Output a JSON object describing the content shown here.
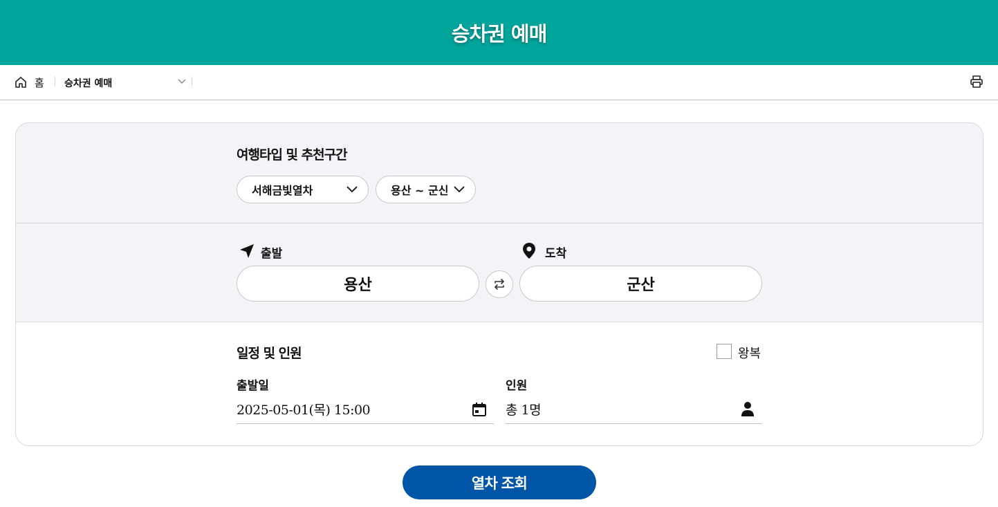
{
  "header": {
    "title": "승차권 예매"
  },
  "breadcrumb": {
    "home": "홈",
    "current": "승차권 예매"
  },
  "trip_type": {
    "title": "여행타입 및 추천구간",
    "type_select": "서해금빛열차",
    "route_select": "용산 ~ 군신"
  },
  "route": {
    "departure_label": "출발",
    "departure_station": "용산",
    "arrival_label": "도착",
    "arrival_station": "군산"
  },
  "schedule": {
    "title": "일정 및 인원",
    "round_trip_label": "왕복",
    "round_trip_checked": false,
    "date_label": "출발일",
    "date_value": "2025-05-01(목) 15:00",
    "passenger_label": "인원",
    "passenger_value": "총 1명"
  },
  "search_button": "열차 조회",
  "colors": {
    "header": "#02a59c",
    "primary_button": "#0055a6",
    "panel": "#f3f4f7"
  }
}
